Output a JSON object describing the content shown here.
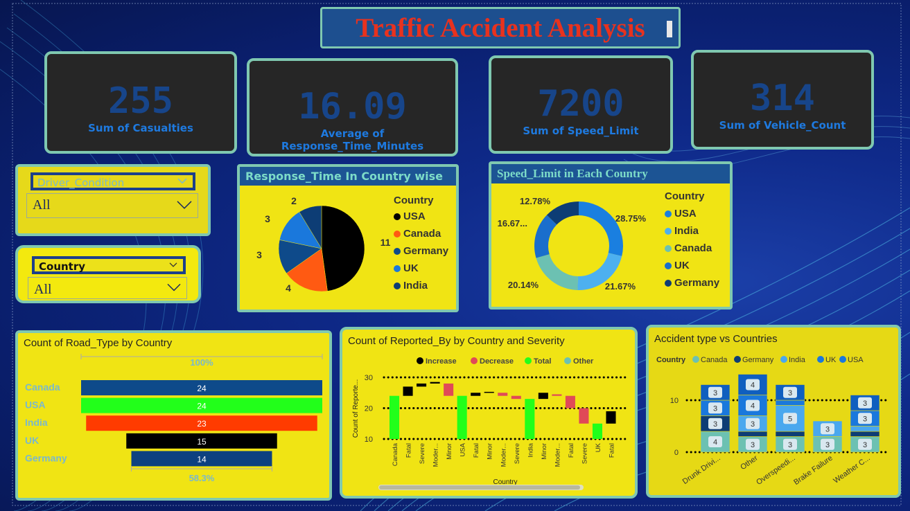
{
  "title": "Traffic Accident Analysis",
  "kpis": [
    {
      "value": "255",
      "label": "Sum of Casualties"
    },
    {
      "value": "16.09",
      "label": "Average of Response_Time_Minutes"
    },
    {
      "value": "7200",
      "label": "Sum of Speed_Limit"
    },
    {
      "value": "314",
      "label": "Sum of Vehicle_Count"
    }
  ],
  "slicers": {
    "driver": {
      "header": "Driver_Condition",
      "value": "All"
    },
    "country": {
      "header": "Country",
      "value": "All"
    }
  },
  "colors": {
    "black": "#000000",
    "orange": "#ff5a12",
    "navy": "#0e4a8a",
    "blue": "#1a78dc",
    "lightblue": "#4aa8ee",
    "teal": "#6cc1b2",
    "green": "#22ff1a",
    "red": "#ff3b00",
    "darkblue": "#0d4180",
    "decrease": "#e04a57"
  },
  "chart_data": [
    {
      "type": "pie",
      "title": "Response_Time In Country wise",
      "legend_title": "Country",
      "labels": [
        "USA",
        "Canada",
        "Germany",
        "UK",
        "India"
      ],
      "values": [
        11,
        4,
        3,
        3,
        2
      ],
      "colors": [
        "#000000",
        "#ff5a12",
        "#0e4a8a",
        "#1a78dc",
        "#0d3d75"
      ]
    },
    {
      "type": "pie",
      "title": "Speed_Limit in Each Country",
      "legend_title": "Country",
      "labels": [
        "USA",
        "India",
        "Canada",
        "UK",
        "Germany"
      ],
      "values": [
        28.75,
        21.67,
        20.14,
        16.67,
        12.78
      ],
      "value_labels": [
        "28.75%",
        "21.67%",
        "20.14%",
        "16.67...",
        "12.78%"
      ],
      "colors": [
        "#1a7fe0",
        "#4db0f0",
        "#6cc1b2",
        "#1a6ecc",
        "#0d3d75"
      ]
    },
    {
      "type": "bar",
      "title": "Count of Road_Type by Country",
      "categories": [
        "Canada",
        "USA",
        "India",
        "UK",
        "Germany"
      ],
      "values": [
        24,
        24,
        23,
        15,
        14
      ],
      "colors": [
        "#0e4a8a",
        "#22ff1a",
        "#ff3b00",
        "#000000",
        "#0d4180"
      ],
      "top_label": "100%",
      "bottom_label": "58.3%"
    },
    {
      "type": "bar",
      "title": "Count of Reported_By by Country and Severity",
      "legend": [
        "Increase",
        "Decrease",
        "Total",
        "Other"
      ],
      "legend_colors": [
        "#000000",
        "#e04a57",
        "#22ff1a",
        "#6cc1b2"
      ],
      "categories": [
        "Canada",
        "Fatal",
        "Severe",
        "Moder...",
        "Minor",
        "USA",
        "Fatal",
        "Minor",
        "Moder...",
        "Severe",
        "India",
        "Minor",
        "Moder...",
        "Fatal",
        "Severe",
        "UK",
        "Fatal"
      ],
      "kinds": [
        "total",
        "inc",
        "inc",
        "inc",
        "dec",
        "total",
        "inc",
        "inc",
        "dec",
        "dec",
        "total",
        "inc",
        "dec",
        "dec",
        "dec",
        "total",
        "inc"
      ],
      "starts": [
        10,
        24,
        27,
        28,
        28,
        10,
        24,
        25,
        25,
        24,
        10,
        23,
        24.5,
        24,
        20,
        10,
        15
      ],
      "ends": [
        24,
        27,
        28,
        28.5,
        24,
        24,
        25,
        25.3,
        24,
        23,
        23,
        25,
        24,
        20,
        15,
        15,
        19
      ],
      "ylabel": "Count of Reporte...",
      "xlabel": "Country",
      "yticks": [
        10,
        20,
        30
      ],
      "ylim": [
        10,
        30
      ]
    },
    {
      "type": "bar",
      "title": "Accident type vs Countries",
      "legend_title": "Country",
      "legend": [
        "Canada",
        "Germany",
        "India",
        "UK",
        "USA"
      ],
      "legend_colors": [
        "#6cc1b2",
        "#0d3d75",
        "#4aa8ee",
        "#1a78dc",
        "#1a78dc"
      ],
      "categories": [
        "Drunk Drivi...",
        "Other",
        "Overspeedi...",
        "Brake Failure",
        "Weather C..."
      ],
      "series": [
        {
          "name": "Canada",
          "values": [
            4,
            3,
            3,
            3,
            3
          ]
        },
        {
          "name": "Germany",
          "values": [
            3,
            1,
            1,
            0,
            1
          ]
        },
        {
          "name": "India",
          "values": [
            0,
            3,
            5,
            3,
            1
          ]
        },
        {
          "name": "UK",
          "values": [
            3,
            4,
            1,
            0,
            3
          ]
        },
        {
          "name": "USA",
          "values": [
            3,
            4,
            3,
            0,
            3
          ]
        }
      ],
      "yticks": [
        0,
        10
      ]
    }
  ]
}
